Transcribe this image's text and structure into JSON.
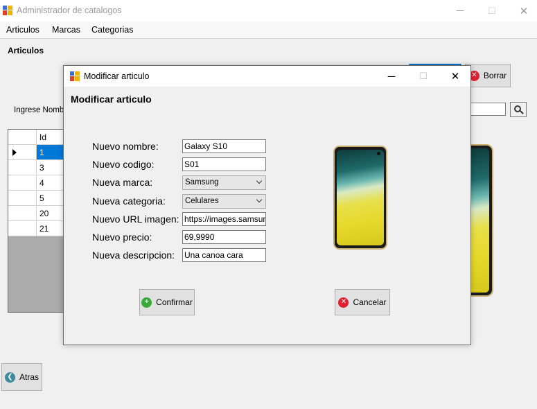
{
  "window": {
    "title": "Administrador de catalogos",
    "controls": {
      "minimize": "─",
      "maximize": "☐",
      "close": "✕"
    }
  },
  "menu": {
    "items": [
      "Articulos",
      "Marcas",
      "Categorias"
    ]
  },
  "main": {
    "section_label": "Articulos",
    "search_label": "Ingrese Nombre",
    "delete_button": "Borrar",
    "back_button": "Atras",
    "grid": {
      "column_header": "Id",
      "rows": [
        "1",
        "3",
        "4",
        "5",
        "20",
        "21"
      ],
      "selected_row": 0
    }
  },
  "dialog": {
    "title": "Modificar articulo",
    "heading": "Modificar articulo",
    "controls": {
      "minimize": "─",
      "maximize": "☐",
      "close": "✕"
    },
    "fields": {
      "nombre": {
        "label": "Nuevo nombre:",
        "value": "Galaxy S10"
      },
      "codigo": {
        "label": "Nuevo codigo:",
        "value": "S01"
      },
      "marca": {
        "label": "Nueva marca:",
        "value": "Samsung"
      },
      "categoria": {
        "label": "Nueva categoria:",
        "value": "Celulares"
      },
      "url_imagen": {
        "label": "Nuevo URL imagen:",
        "value": "https://images.samsung"
      },
      "precio": {
        "label": "Nuevo precio:",
        "value": "69,9990"
      },
      "descripcion": {
        "label": "Nueva descripcion:",
        "value": "Una canoa cara"
      }
    },
    "confirm_button": "Confirmar",
    "cancel_button": "Cancelar"
  },
  "icons": {
    "app": "app-grid-icon",
    "delete": "x-circle-icon",
    "confirm": "plus-circle-icon",
    "cancel": "x-circle-icon",
    "back": "left-arrow-circle-icon",
    "search": "search-icon"
  },
  "colors": {
    "selection": "#0078d7",
    "delete_red": "#e02030",
    "confirm_green": "#3ba83b",
    "back_teal": "#3c8aa0"
  }
}
